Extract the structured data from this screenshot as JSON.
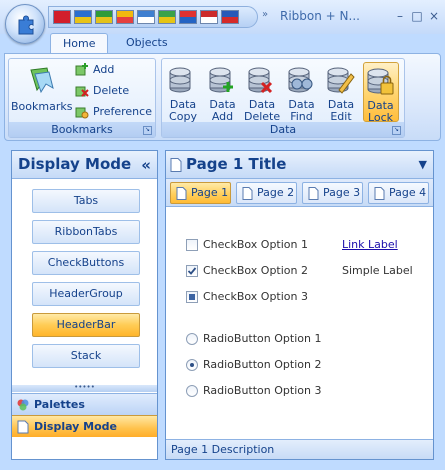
{
  "window": {
    "title": "Ribbon + N...",
    "qat_more": "»",
    "controls": {
      "minimize": "–",
      "maximize": "□",
      "close": "×"
    },
    "flag_colors": [
      [
        "#d21e2b",
        "#d21e2b"
      ],
      [
        "#2a6fd0",
        "#e8c317"
      ],
      [
        "#2e9b3a",
        "#e3c21b"
      ],
      [
        "#f2b90f",
        "#e54040"
      ],
      [
        "#3f7fd0",
        "#ffffff"
      ],
      [
        "#3aa24a",
        "#e5c414"
      ],
      [
        "#e03131",
        "#2463c3"
      ],
      [
        "#cc2b2b",
        "#ffffff"
      ],
      [
        "#2859b8",
        "#d52a2a"
      ]
    ]
  },
  "ribbon": {
    "tabs": [
      {
        "label": "Home",
        "active": true
      },
      {
        "label": "Objects",
        "active": false
      }
    ],
    "bookmarks_group": {
      "caption": "Bookmarks",
      "big_button": "Bookmarks",
      "small_buttons": [
        "Add",
        "Delete",
        "Preference"
      ]
    },
    "data_group": {
      "caption": "Data",
      "buttons": [
        {
          "line1": "Data",
          "line2": "Copy"
        },
        {
          "line1": "Data",
          "line2": "Add"
        },
        {
          "line1": "Data",
          "line2": "Delete"
        },
        {
          "line1": "Data",
          "line2": "Find"
        },
        {
          "line1": "Data",
          "line2": "Edit"
        },
        {
          "line1": "Data",
          "line2": "Lock",
          "selected": true
        }
      ]
    }
  },
  "navigator": {
    "title": "Display Mode",
    "collapse": "«",
    "buttons": [
      "Tabs",
      "RibbonTabs",
      "CheckButtons",
      "HeaderGroup",
      "HeaderBar",
      "Stack"
    ],
    "selected_button": "HeaderBar",
    "splitter": "•••••",
    "stacks": [
      {
        "label": "Palettes",
        "selected": false
      },
      {
        "label": "Display Mode",
        "selected": true
      }
    ]
  },
  "page": {
    "title": "Page 1 Title",
    "dropdown": "▼",
    "tabs": [
      "Page 1",
      "Page 2",
      "Page 3",
      "Page 4"
    ],
    "selected_tab": "Page 1",
    "checkboxes": [
      {
        "label": "CheckBox Option 1",
        "state": "unchecked"
      },
      {
        "label": "CheckBox Option 2",
        "state": "checked"
      },
      {
        "label": "CheckBox Option 3",
        "state": "indeterminate"
      }
    ],
    "link_label": "Link Label",
    "simple_label": "Simple Label",
    "radios": [
      {
        "label": "RadioButton Option 1",
        "checked": false
      },
      {
        "label": "RadioButton Option 2",
        "checked": true
      },
      {
        "label": "RadioButton Option 3",
        "checked": false
      }
    ],
    "description": "Page 1 Description"
  },
  "colors": {
    "accent_text": "#15428b",
    "selected_orange": "#ffbd3a",
    "panel_border": "#6593cf"
  }
}
